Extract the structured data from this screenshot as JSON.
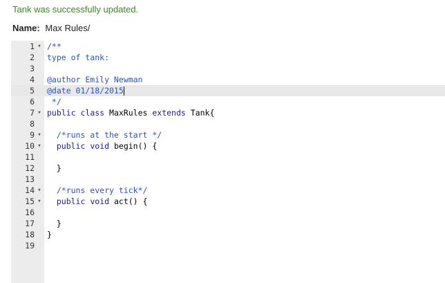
{
  "notice": "Tank was successfully updated.",
  "name": {
    "label": "Name:",
    "value": "Max Rules/"
  },
  "editor": {
    "active_line": 5,
    "lines": [
      {
        "n": "1",
        "fold": "▾",
        "text": "/**"
      },
      {
        "n": "2",
        "fold": "",
        "text": "type of tank:"
      },
      {
        "n": "3",
        "fold": "",
        "text": ""
      },
      {
        "n": "4",
        "fold": "",
        "text": "@author Emily Newman"
      },
      {
        "n": "5",
        "fold": "",
        "text": "@date 01/18/2015"
      },
      {
        "n": "6",
        "fold": "",
        "text": " */"
      },
      {
        "n": "7",
        "fold": "▾",
        "text": "public class MaxRules extends Tank{"
      },
      {
        "n": "8",
        "fold": "",
        "text": ""
      },
      {
        "n": "9",
        "fold": "▾",
        "text": "  /*runs at the start */"
      },
      {
        "n": "10",
        "fold": "▾",
        "text": "  public void begin() {"
      },
      {
        "n": "11",
        "fold": "",
        "text": ""
      },
      {
        "n": "12",
        "fold": "",
        "text": "  }"
      },
      {
        "n": "13",
        "fold": "",
        "text": ""
      },
      {
        "n": "14",
        "fold": "▾",
        "text": "  /*runs every tick*/"
      },
      {
        "n": "15",
        "fold": "▾",
        "text": "  public void act() {"
      },
      {
        "n": "16",
        "fold": "",
        "text": ""
      },
      {
        "n": "17",
        "fold": "",
        "text": "  }"
      },
      {
        "n": "18",
        "fold": "",
        "text": "}"
      },
      {
        "n": "19",
        "fold": "",
        "text": ""
      }
    ]
  },
  "colors": {
    "notice": "#3a8a1c",
    "comment": "#2b50c8",
    "keyword": "#1a1aa6",
    "gutter": "#ececec",
    "active_line": "#e8e8e8"
  }
}
